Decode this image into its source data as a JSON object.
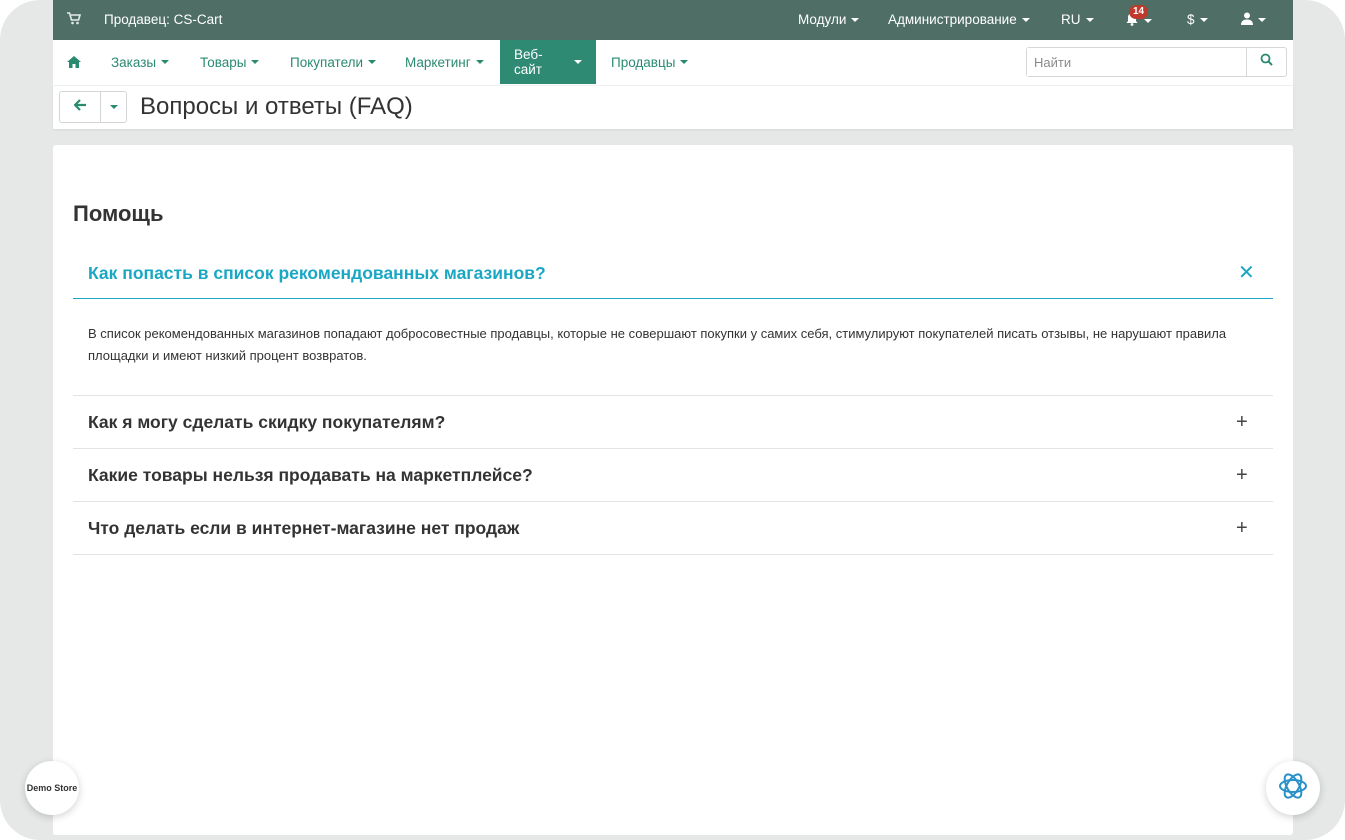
{
  "topbar": {
    "vendor": "Продавец: CS-Cart",
    "modules": "Модули",
    "admin": "Администрирование",
    "lang": "RU",
    "notifications_count": "14",
    "currency": "$"
  },
  "nav": {
    "items": [
      "Заказы",
      "Товары",
      "Покупатели",
      "Маркетинг",
      "Веб-сайт",
      "Продавцы"
    ],
    "active": "Веб-сайт",
    "search_placeholder": "Найти"
  },
  "page": {
    "title": "Вопросы и ответы (FAQ)"
  },
  "faq": {
    "section_title": "Помощь",
    "items": [
      {
        "question": "Как попасть в список рекомендованных магазинов?",
        "expanded": true,
        "answer": "В список рекомендованных магазинов попадают добросовестные продавцы, которые не совершают покупки у самих себя, стимулируют покупателей писать отзывы, не нарушают правила площадки и имеют низкий процент возвратов."
      },
      {
        "question": "Как я могу сделать скидку покупателям?",
        "expanded": false
      },
      {
        "question": "Какие товары нельзя продавать на маркетплейсе?",
        "expanded": false
      },
      {
        "question": "Что делать если в интернет-магазине нет продаж",
        "expanded": false
      }
    ]
  },
  "widgets": {
    "demo_store": "Demo Store"
  },
  "colors": {
    "topbar": "#4f6f66",
    "nav_link": "#2a8a70",
    "active_tab": "#2f8a73",
    "accent": "#1aa7c4",
    "badge": "#c0392b"
  },
  "icons": [
    "cart-icon",
    "bell-icon",
    "user-icon",
    "home-icon",
    "search-icon",
    "arrow-left-icon",
    "close-icon",
    "plus-icon"
  ]
}
